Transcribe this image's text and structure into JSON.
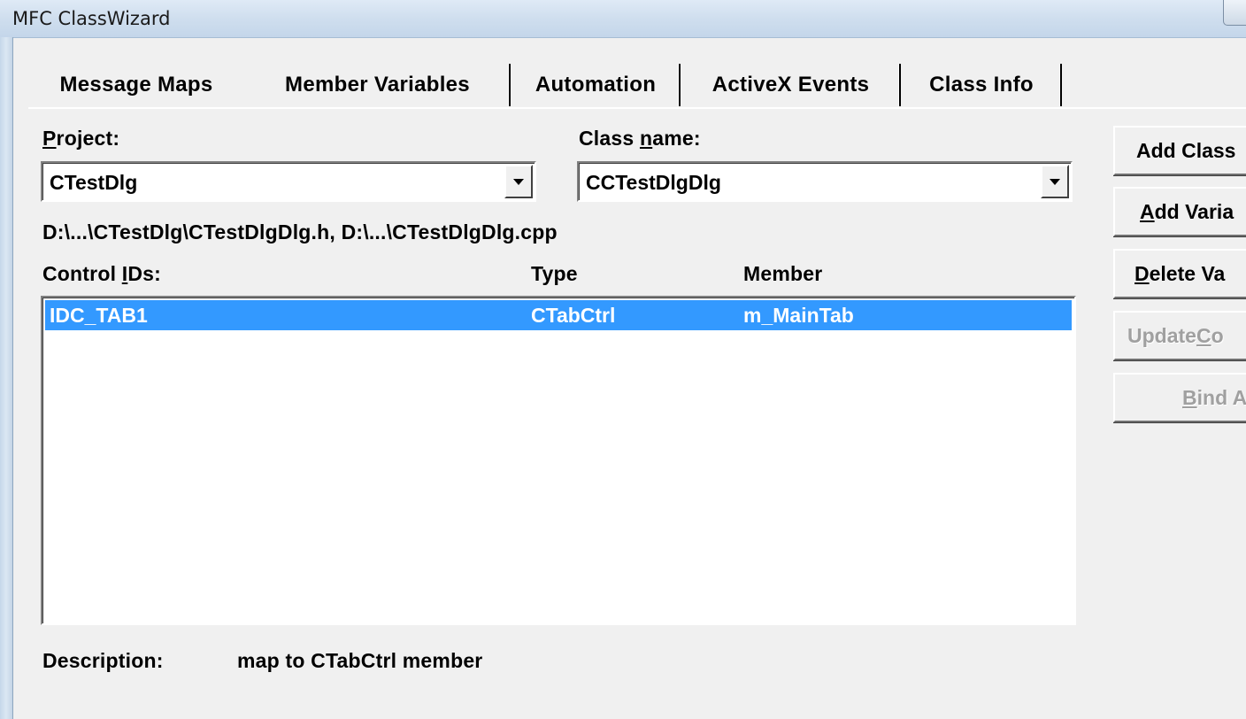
{
  "window": {
    "title": "MFC ClassWizard"
  },
  "tabs": [
    {
      "label": "Message Maps",
      "active": false
    },
    {
      "label": "Member Variables",
      "active": true
    },
    {
      "label": "Automation",
      "active": false
    },
    {
      "label": "ActiveX Events",
      "active": false
    },
    {
      "label": "Class Info",
      "active": false
    }
  ],
  "project": {
    "label_underlined": "P",
    "label_rest": "roject:",
    "value": "CTestDlg"
  },
  "class_name": {
    "label_pre": "Class ",
    "label_underlined": "n",
    "label_post": "ame:",
    "value": "CCTestDlgDlg"
  },
  "file_paths": "D:\\...\\CTestDlg\\CTestDlgDlg.h, D:\\...\\CTestDlgDlg.cpp",
  "list": {
    "headers": {
      "control_ids_pre": "Control ",
      "control_ids_underlined": "I",
      "control_ids_post": "Ds:",
      "type": "Type",
      "member": "Member"
    },
    "rows": [
      {
        "control_id": "IDC_TAB1",
        "type": "CTabCtrl",
        "member": "m_MainTab",
        "selected": true
      }
    ]
  },
  "description": {
    "label": "Description:",
    "value": "map to CTabCtrl member"
  },
  "buttons": {
    "add_class": {
      "text": "Add Class"
    },
    "add_variable": {
      "underlined": "A",
      "rest": "dd Varia"
    },
    "delete_variable": {
      "underlined": "D",
      "rest": "elete Va"
    },
    "update_columns": {
      "pre": "Update ",
      "underlined": "C",
      "post": "o"
    },
    "bind_all": {
      "underlined": "B",
      "rest": "ind A"
    }
  },
  "colors": {
    "selection": "#3399ff",
    "dialog_bg": "#f0f0f0"
  }
}
